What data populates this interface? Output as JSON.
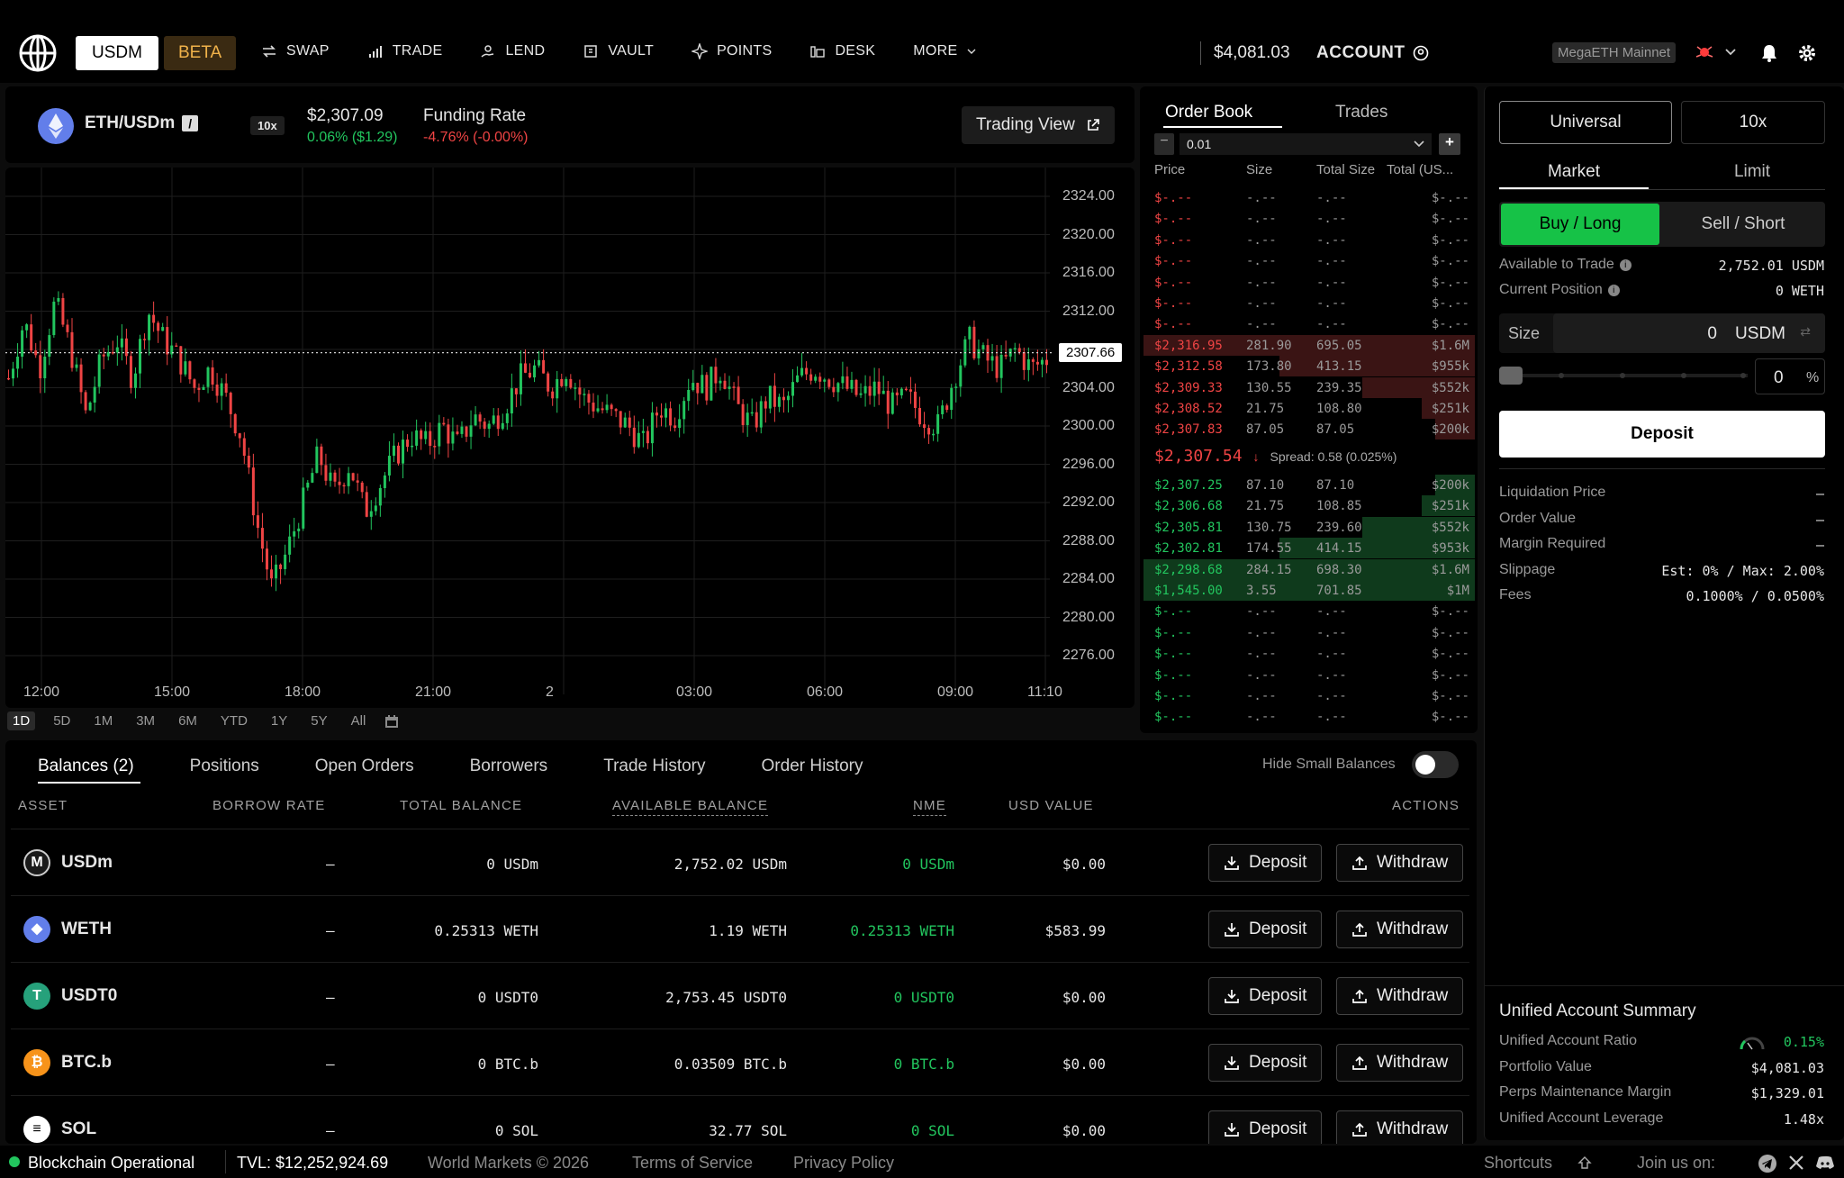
{
  "nav": {
    "usdm_label": "USDM",
    "beta_label": "BETA",
    "links": [
      {
        "label": "SWAP",
        "icon": "swap-icon"
      },
      {
        "label": "TRADE",
        "icon": "bar-chart-icon"
      },
      {
        "label": "LEND",
        "icon": "lend-icon"
      },
      {
        "label": "VAULT",
        "icon": "vault-icon"
      },
      {
        "label": "POINTS",
        "icon": "sparkle-icon"
      },
      {
        "label": "DESK",
        "icon": "desk-icon"
      },
      {
        "label": "MORE",
        "icon": "chevron-down-icon"
      }
    ],
    "balance": "$4,081.03",
    "account_label": "ACCOUNT",
    "network": "MegaETH Mainnet"
  },
  "market": {
    "pair": "ETH/USDm",
    "pair_badge": "/",
    "leverage": "10x",
    "price": "$2,307.09",
    "change": "0.06% ($1.29)",
    "funding_label": "Funding Rate",
    "funding_value": "-4.76% (-0.00%)",
    "trading_view_label": "Trading View"
  },
  "chart": {
    "current_price_label": "2307.66",
    "timeframes": [
      "1D",
      "5D",
      "1M",
      "3M",
      "6M",
      "YTD",
      "1Y",
      "5Y",
      "All"
    ],
    "active_timeframe": "1D"
  },
  "chart_data": {
    "type": "candlestick",
    "title": "",
    "y_ticks": [
      "2324.00",
      "2320.00",
      "2316.00",
      "2312.00",
      "2308.00",
      "2304.00",
      "2300.00",
      "2296.00",
      "2292.00",
      "2288.00",
      "2284.00",
      "2280.00",
      "2276.00"
    ],
    "x_ticks": [
      "12:00",
      "15:00",
      "18:00",
      "21:00",
      "2",
      "03:00",
      "06:00",
      "09:00",
      "11:10"
    ],
    "ylim": [
      2274,
      2326
    ],
    "close_path": [
      2305,
      2311,
      2306,
      2313,
      2308,
      2301,
      2307,
      2309,
      2305,
      2312,
      2309,
      2307,
      2304,
      2306,
      2303,
      2299,
      2290,
      2283,
      2287,
      2292,
      2297,
      2293,
      2296,
      2291,
      2294,
      2297,
      2299,
      2298,
      2300,
      2298,
      2301,
      2300,
      2302,
      2305,
      2306,
      2304,
      2306,
      2303,
      2302,
      2301,
      2300,
      2298,
      2302,
      2301,
      2305,
      2304,
      2306,
      2302,
      2300,
      2303,
      2302,
      2305,
      2306,
      2305,
      2304,
      2303,
      2304,
      2302,
      2303,
      2301,
      2300,
      2305,
      2309,
      2307,
      2306,
      2308,
      2306,
      2307
    ],
    "last_price": 2307.66
  },
  "orderbook": {
    "tabs": [
      "Order Book",
      "Trades"
    ],
    "tick_size": "0.01",
    "headers": [
      "Price",
      "Size",
      "Total Size",
      "Total (US..."
    ],
    "empty_row": [
      "$-.--",
      "-.--",
      "-.--",
      "$-.--"
    ],
    "asks": [
      [
        "$2,316.95",
        "281.90",
        "695.05",
        "$1.6M"
      ],
      [
        "$2,312.58",
        "173.80",
        "413.15",
        "$955k"
      ],
      [
        "$2,309.33",
        "130.55",
        "239.35",
        "$552k"
      ],
      [
        "$2,308.52",
        "21.75",
        "108.80",
        "$251k"
      ],
      [
        "$2,307.83",
        "87.05",
        "87.05",
        "$200k"
      ]
    ],
    "ask_depth": [
      1.0,
      0.59,
      0.34,
      0.16,
      0.12
    ],
    "mid_price": "$2,307.54",
    "spread": "Spread: 0.58 (0.025%)",
    "bids": [
      [
        "$2,307.25",
        "87.10",
        "87.10",
        "$200k"
      ],
      [
        "$2,306.68",
        "21.75",
        "108.85",
        "$251k"
      ],
      [
        "$2,305.81",
        "130.75",
        "239.60",
        "$552k"
      ],
      [
        "$2,302.81",
        "174.55",
        "414.15",
        "$953k"
      ],
      [
        "$2,298.68",
        "284.15",
        "698.30",
        "$1.6M"
      ],
      [
        "$1,545.00",
        "3.55",
        "701.85",
        "$1M"
      ]
    ],
    "bid_depth": [
      0.12,
      0.16,
      0.34,
      0.59,
      1.0,
      1.0
    ]
  },
  "trade_panel": {
    "mode": "Universal",
    "leverage": "10x",
    "order_tabs": [
      "Market",
      "Limit"
    ],
    "buy_label": "Buy / Long",
    "sell_label": "Sell / Short",
    "available_label": "Available to Trade",
    "available_value": "2,752.01 USDM",
    "position_label": "Current Position",
    "position_value": "0 WETH",
    "size_label": "Size",
    "size_value": "0",
    "size_unit": "USDM",
    "slider_value": "0",
    "percent_sign": "%",
    "deposit_label": "Deposit",
    "details": [
      [
        "Liquidation Price",
        "–"
      ],
      [
        "Order Value",
        "–"
      ],
      [
        "Margin Required",
        "–"
      ],
      [
        "Slippage",
        "Est: 0% / Max: 2.00%"
      ],
      [
        "Fees",
        "0.1000% / 0.0500%"
      ]
    ],
    "summary_title": "Unified Account Summary",
    "summary": [
      [
        "Unified Account Ratio",
        "0.15%"
      ],
      [
        "Portfolio Value",
        "$4,081.03"
      ],
      [
        "Perps Maintenance Margin",
        "$1,329.01"
      ],
      [
        "Unified Account Leverage",
        "1.48x"
      ]
    ]
  },
  "balances": {
    "tabs": [
      "Balances (2)",
      "Positions",
      "Open Orders",
      "Borrowers",
      "Trade History",
      "Order History"
    ],
    "hide_small_label": "Hide Small Balances",
    "headers": [
      "ASSET",
      "BORROW RATE",
      "TOTAL BALANCE",
      "AVAILABLE BALANCE",
      "NME",
      "USD VALUE",
      "ACTIONS"
    ],
    "deposit_label": "Deposit",
    "withdraw_label": "Withdraw",
    "rows": [
      {
        "asset": "USDm",
        "icon": "usdm-icon",
        "color": "#1a1a1a",
        "borrow": "–",
        "total": "0 USDm",
        "available": "2,752.02 USDm",
        "nme": "0 USDm",
        "usd": "$0.00"
      },
      {
        "asset": "WETH",
        "icon": "eth-icon",
        "color": "#627eea",
        "borrow": "–",
        "total": "0.25313 WETH",
        "available": "1.19 WETH",
        "nme": "0.25313 WETH",
        "usd": "$583.99"
      },
      {
        "asset": "USDT0",
        "icon": "tether-icon",
        "color": "#26a17b",
        "borrow": "–",
        "total": "0 USDT0",
        "available": "2,753.45 USDT0",
        "nme": "0 USDT0",
        "usd": "$0.00"
      },
      {
        "asset": "BTC.b",
        "icon": "bitcoin-icon",
        "color": "#f7931a",
        "borrow": "–",
        "total": "0 BTC.b",
        "available": "0.03509 BTC.b",
        "nme": "0 BTC.b",
        "usd": "$0.00"
      },
      {
        "asset": "SOL",
        "icon": "solana-icon",
        "color": "#ffffff",
        "borrow": "–",
        "total": "0 SOL",
        "available": "32.77 SOL",
        "nme": "0 SOL",
        "usd": "$0.00"
      }
    ]
  },
  "footer": {
    "status": "Blockchain Operational",
    "tvl": "TVL: $12,252,924.69",
    "copyright": "World Markets © 2026",
    "terms": "Terms of Service",
    "privacy": "Privacy Policy",
    "shortcuts": "Shortcuts",
    "join": "Join us on:"
  },
  "colors": {
    "green": "#22c55e",
    "red": "#ef4444",
    "accent_buy": "#16c247"
  }
}
